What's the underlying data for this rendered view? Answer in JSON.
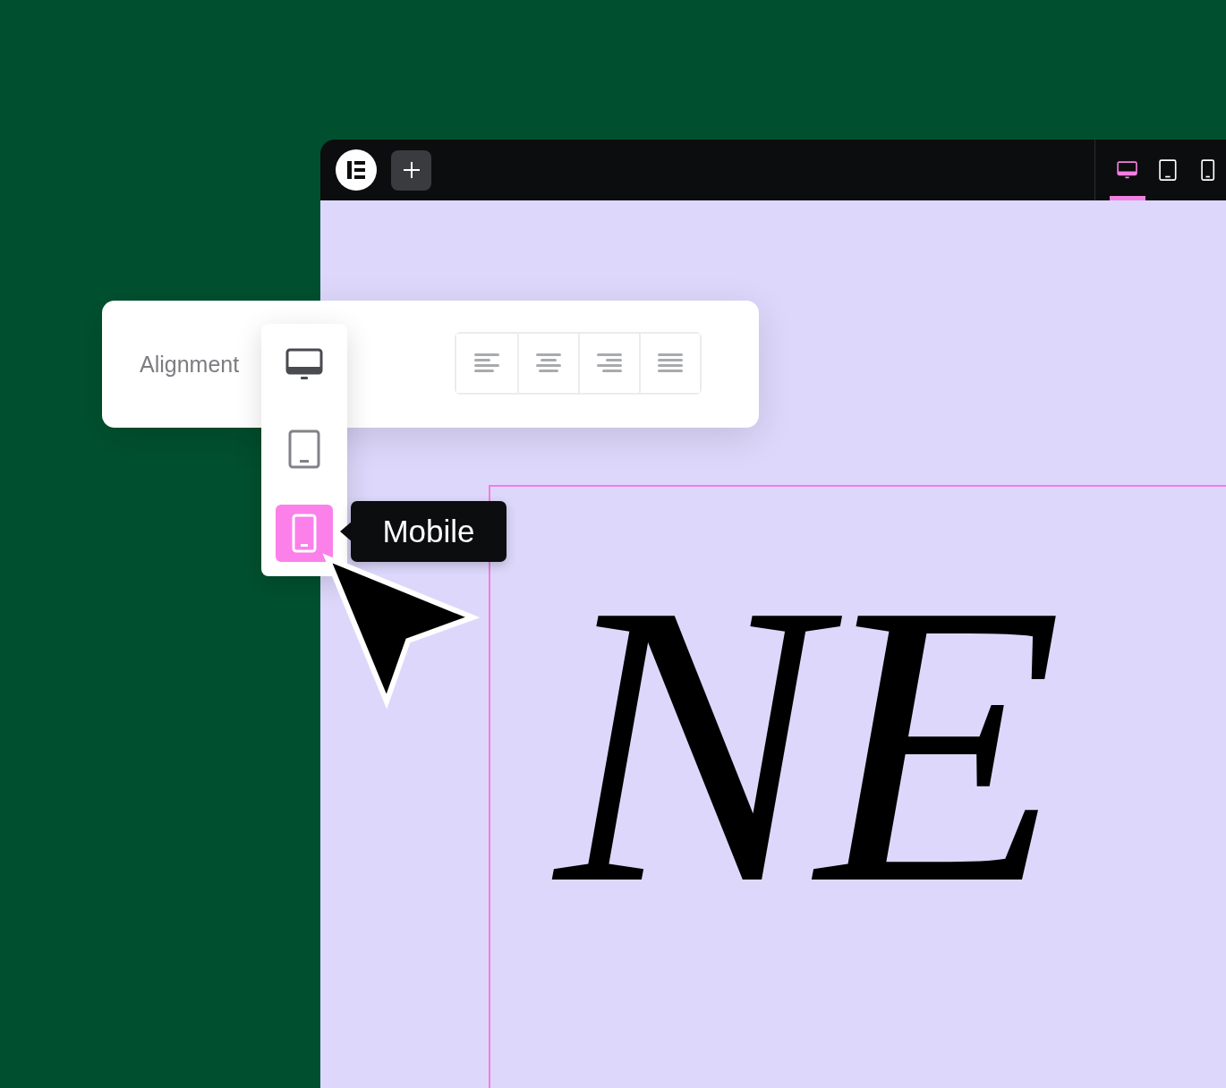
{
  "editor": {
    "toolbar": {
      "devices": [
        {
          "kind": "desktop",
          "selected": true
        },
        {
          "kind": "tablet",
          "selected": false
        },
        {
          "kind": "mobile",
          "selected": false
        }
      ]
    },
    "canvas": {
      "heading": "NE"
    }
  },
  "alignment_control": {
    "label": "Alignment",
    "device_menu": {
      "items": [
        {
          "kind": "desktop",
          "selected": false
        },
        {
          "kind": "tablet",
          "selected": false
        },
        {
          "kind": "mobile",
          "selected": true
        }
      ],
      "tooltip": "Mobile"
    },
    "options": [
      {
        "kind": "left"
      },
      {
        "kind": "center"
      },
      {
        "kind": "right"
      },
      {
        "kind": "justify"
      }
    ]
  }
}
